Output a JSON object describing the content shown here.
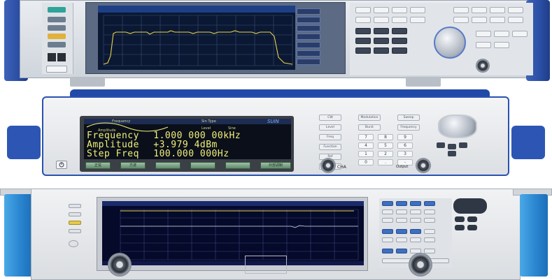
{
  "image": {
    "description_instruments": 3
  },
  "middle_display": {
    "title": "Frequency",
    "subtitle": "Amplitude",
    "header_level": "Level",
    "header_mode": "Sine",
    "header_wave": "Sin Type",
    "brand": "SUIN",
    "lines": [
      {
        "label": "Frequency",
        "value": "1.000 000 00kHz"
      },
      {
        "label": "Amplitude",
        "value": "+3.979 4dBm"
      },
      {
        "label": "Step Freq",
        "value": "100.000 000Hz"
      }
    ],
    "softkeys": [
      "正弦",
      "方波",
      "",
      "",
      "",
      "外部调制"
    ]
  },
  "middle_panel": {
    "func_keys": [
      "CW",
      "Modulation",
      "Sweep",
      "Level",
      "Burst",
      "Frequency",
      "Freq",
      "Function",
      "Ref",
      "Output"
    ],
    "numpad": [
      "7",
      "8",
      "9",
      "4",
      "5",
      "6",
      "1",
      "2",
      "3",
      "0",
      ".",
      "-"
    ],
    "channel_label": "CHA",
    "output_label": "Output"
  },
  "colors": {
    "top_handle": "#2a4ea3",
    "middle_body_accent": "#2149a8",
    "bottom_handle": "#2b86d1",
    "trace_yellow": "#e8d24a",
    "display_bg": "#0b1833"
  }
}
